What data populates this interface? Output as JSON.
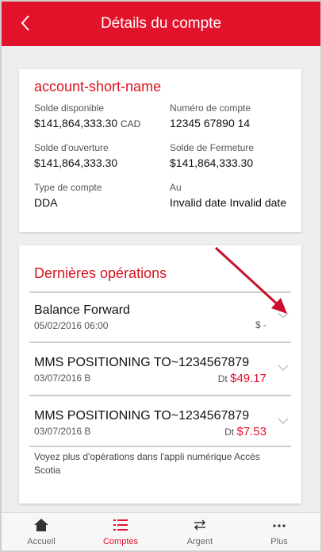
{
  "header": {
    "title": "Détails du compte"
  },
  "account": {
    "name": "account-short-name",
    "fields": {
      "available_label": "Solde disponible",
      "available_value": "$141,864,333.30",
      "available_currency": "CAD",
      "account_number_label": "Numéro de compte",
      "account_number_value": "12345 67890 14",
      "opening_label": "Solde d'ouverture",
      "opening_value": "$141,864,333.30",
      "closing_label": "Solde de Fermeture",
      "closing_value": "$141,864,333.30",
      "type_label": "Type de compte",
      "type_value": "DDA",
      "au_label": "Au",
      "au_value": "Invalid date Invalid date"
    }
  },
  "transactions": {
    "title": "Dernières opérations",
    "items": [
      {
        "name": "Balance Forward",
        "date": "05/02/2016 06:00",
        "prefix": "$ -",
        "amount": ""
      },
      {
        "name": "MMS POSITIONING TO~1234567879",
        "date": "03/07/2016 B",
        "prefix": "Dt",
        "amount": "$49.17"
      },
      {
        "name": "MMS POSITIONING TO~1234567879",
        "date": "03/07/2016 B",
        "prefix": "Dt",
        "amount": "$7.53"
      }
    ],
    "more_text": "Voyez plus d'opérations dans l'appli numérique Accès Scotia"
  },
  "tabs": [
    {
      "label": "Accueil",
      "icon": "home-icon",
      "active": false
    },
    {
      "label": "Comptes",
      "icon": "list-icon",
      "active": true
    },
    {
      "label": "Argent",
      "icon": "transfer-arrows-icon",
      "active": false
    },
    {
      "label": "Plus",
      "icon": "more-dots-icon",
      "active": false
    }
  ],
  "colors": {
    "brand_red": "#e2122a",
    "annotation_arrow": "#c8102e"
  }
}
